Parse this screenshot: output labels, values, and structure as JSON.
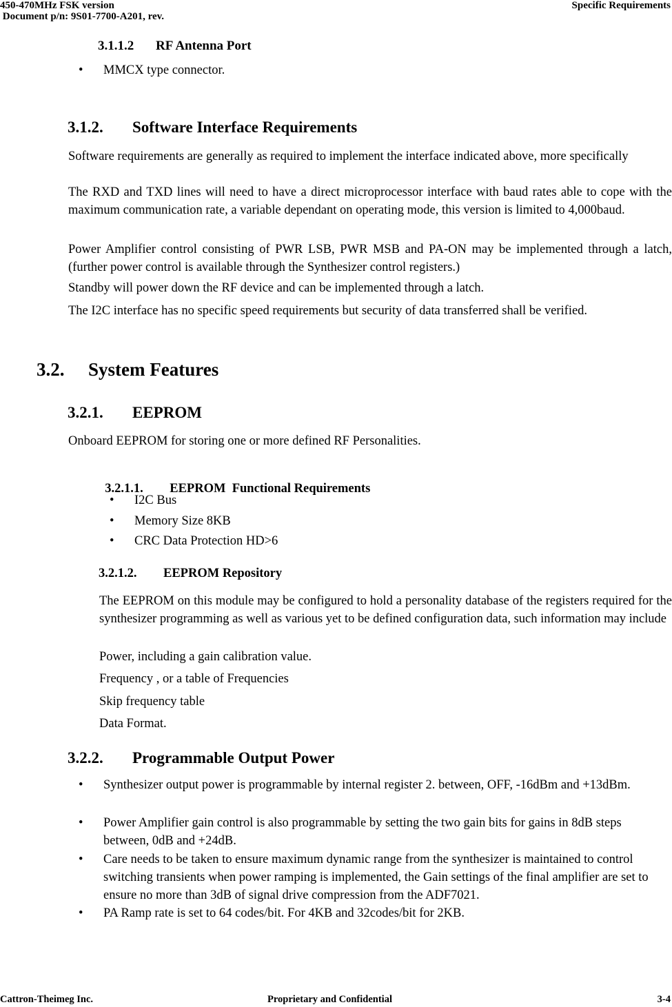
{
  "header": {
    "left_line1": "450-470MHz FSK version",
    "left_line2": " Document p/n: 9S01-7700-A201, rev.",
    "right": "Specific Requirements"
  },
  "footer": {
    "company": "Cattron-Theimeg Inc.",
    "notice": "Proprietary and Confidential",
    "page": "3-4"
  },
  "bullet_glyph": "•",
  "sections": {
    "s3112": {
      "number": "3.1.1.2",
      "title": "RF Antenna Port",
      "bullets": [
        "MMCX type connector."
      ]
    },
    "s312": {
      "number": "3.1.2.",
      "title": "Software Interface Requirements",
      "paragraphs": [
        "Software requirements are generally as required to implement the interface indicated above, more specifically",
        "The RXD and TXD lines will need to have a direct microprocessor interface with baud rates able to cope with the maximum communication rate, a variable dependant on operating mode, this version is limited to 4,000baud.",
        "Power Amplifier control consisting of PWR LSB, PWR MSB and PA-ON may be implemented through a latch, (further power control is available through the Synthesizer control registers.)",
        "Standby will power down the RF device and can be implemented through a latch.",
        "The I2C interface has no specific speed requirements but security of data transferred shall be verified."
      ]
    },
    "s32": {
      "number": "3.2.",
      "title": "System Features"
    },
    "s321": {
      "number": "3.2.1.",
      "title": "EEPROM",
      "paragraph": "Onboard EEPROM for storing one or more defined RF Personalities."
    },
    "s3211": {
      "number": "3.2.1.1.",
      "title": "EEPROM  Functional Requirements",
      "bullets": [
        "I2C Bus",
        "Memory Size 8KB",
        "CRC Data Protection HD>6"
      ]
    },
    "s3212": {
      "number": "3.2.1.2.",
      "title": "EEPROM Repository",
      "paragraphs": [
        "The EEPROM on this module may be configured to hold a personality database of the registers required for the synthesizer programming as well as various yet to be defined configuration data, such information may include",
        "Power, including a gain calibration value.",
        "Frequency , or a table of Frequencies",
        "Skip frequency table",
        "Data Format."
      ]
    },
    "s322": {
      "number": "3.2.2.",
      "title": "Programmable Output Power",
      "bullets": [
        "Synthesizer output power is programmable by internal register 2. between, OFF, -16dBm and +13dBm.",
        "Power Amplifier gain control is also programmable by setting the two gain bits for gains in 8dB steps between, 0dB and +24dB.",
        "Care needs to be taken to ensure maximum dynamic range from the synthesizer is maintained to control switching transients when power ramping is implemented, the Gain settings of the final amplifier are set to ensure no more than 3dB of signal drive compression from the ADF7021.",
        "PA Ramp rate is set to 64 codes/bit. For 4KB and 32codes/bit for 2KB."
      ]
    }
  }
}
